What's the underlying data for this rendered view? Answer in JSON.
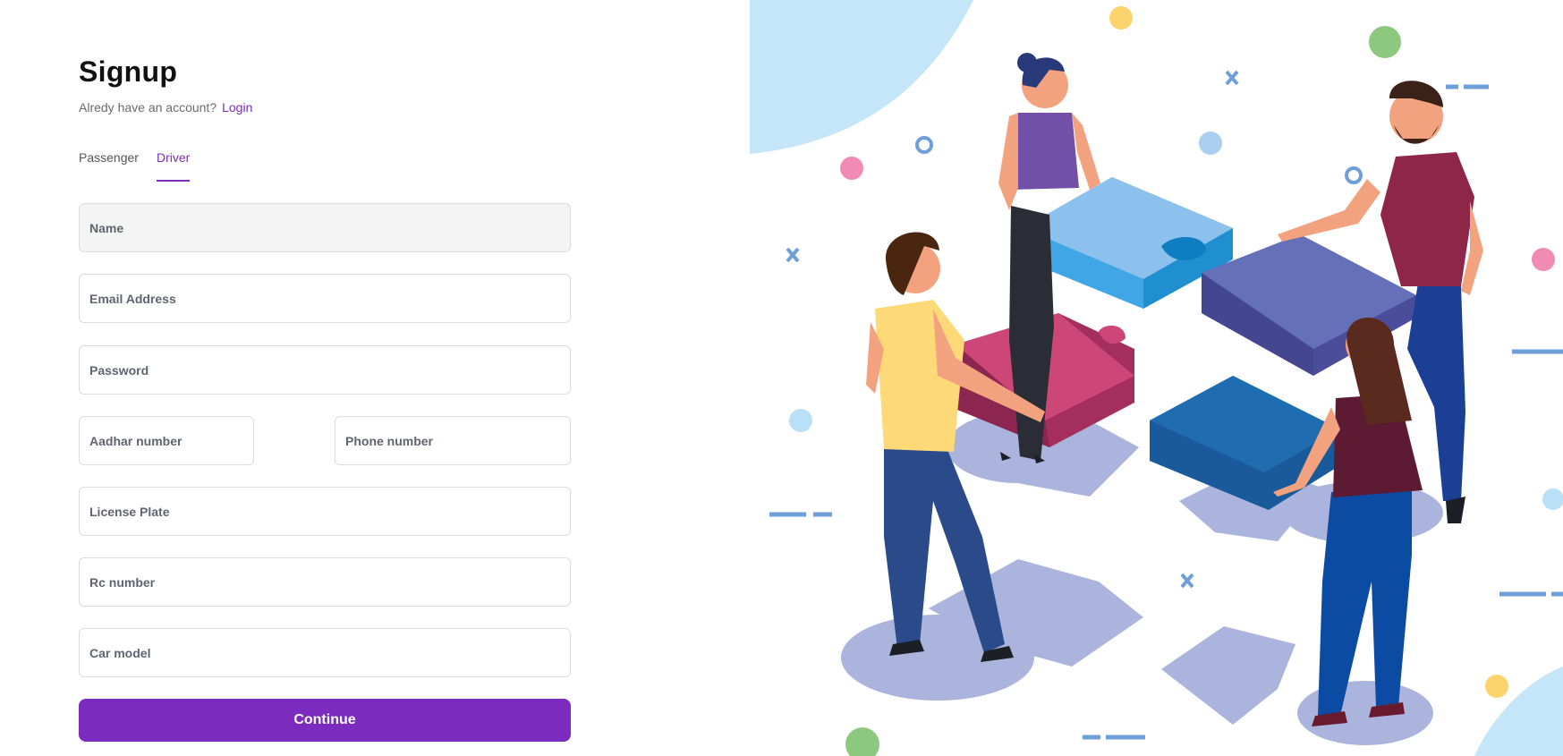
{
  "signup": {
    "title": "Signup",
    "have_account": "Alredy have an account?",
    "login_link": "Login"
  },
  "tabs": [
    {
      "label": "Passenger",
      "active": false
    },
    {
      "label": "Driver",
      "active": true
    }
  ],
  "fields": {
    "name": {
      "placeholder": "Name"
    },
    "email": {
      "placeholder": "Email Address"
    },
    "password": {
      "placeholder": "Password"
    },
    "aadhar": {
      "placeholder": "Aadhar number"
    },
    "phone": {
      "placeholder": "Phone number"
    },
    "license": {
      "placeholder": "License Plate"
    },
    "rc": {
      "placeholder": "Rc number"
    },
    "car": {
      "placeholder": "Car model"
    }
  },
  "continue_label": "Continue",
  "colors": {
    "accent": "#7b2cbf",
    "field_border": "#dcdcdc",
    "name_fill": "#f4f4f4"
  },
  "illustration": {
    "semantic": "people-assembling-puzzle-pieces-illustration"
  }
}
